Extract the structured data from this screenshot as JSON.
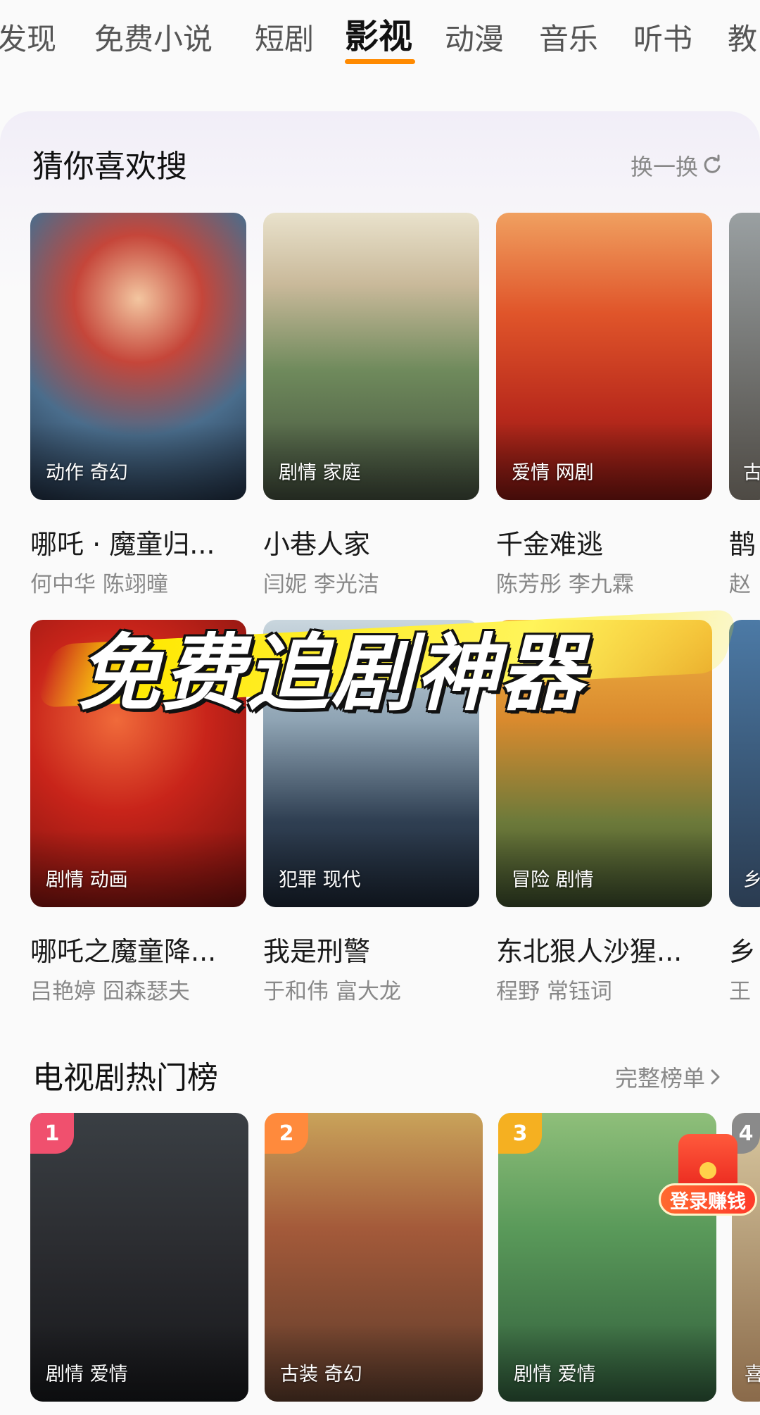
{
  "tabs": [
    {
      "label": "发现"
    },
    {
      "label": "免费小说"
    },
    {
      "label": "短剧"
    },
    {
      "label": "影视"
    },
    {
      "label": "动漫"
    },
    {
      "label": "音乐"
    },
    {
      "label": "听书"
    },
    {
      "label": "教"
    }
  ],
  "active_tab": "影视",
  "accent_color": "#ff8a00",
  "guess": {
    "title": "猜你喜欢搜",
    "refresh_label": "换一换",
    "refresh_icon": "refresh-icon",
    "items": [
      {
        "tag": "动作 奇幻",
        "title": "哪吒 · 魔童归...",
        "cast": "何中华 陈翊曈"
      },
      {
        "tag": "剧情 家庭",
        "title": "小巷人家",
        "cast": "闫妮 李光洁"
      },
      {
        "tag": "爱情 网剧",
        "title": "千金难逃",
        "cast": "陈芳彤 李九霖"
      },
      {
        "tag": "古",
        "title": "鹊",
        "cast": "赵"
      },
      {
        "tag": "剧情 动画",
        "title": "哪吒之魔童降...",
        "cast": "吕艳婷 囧森瑟夫"
      },
      {
        "tag": "犯罪 现代",
        "title": "我是刑警",
        "cast": "于和伟 富大龙"
      },
      {
        "tag": "冒险 剧情",
        "title": "东北狠人沙猩...",
        "cast": "程野 常钰词"
      },
      {
        "tag": "乡",
        "title": "乡",
        "cast": "王"
      }
    ]
  },
  "banner_text": "免费追剧神器",
  "hot": {
    "title": "电视剧热门榜",
    "more_label": "完整榜单",
    "more_icon": "chevron-right-icon",
    "items": [
      {
        "rank": "1",
        "tag": "剧情 爱情",
        "rank_color": "#f0506e"
      },
      {
        "rank": "2",
        "tag": "古装 奇幻",
        "rank_color": "#ff8a3c"
      },
      {
        "rank": "3",
        "tag": "剧情 爱情",
        "rank_color": "#f5b021"
      },
      {
        "rank": "4",
        "tag": "喜",
        "rank_color": "#8a8a8a"
      }
    ]
  },
  "float_badge": {
    "label": "登录赚钱",
    "icon": "red-envelope-icon"
  }
}
